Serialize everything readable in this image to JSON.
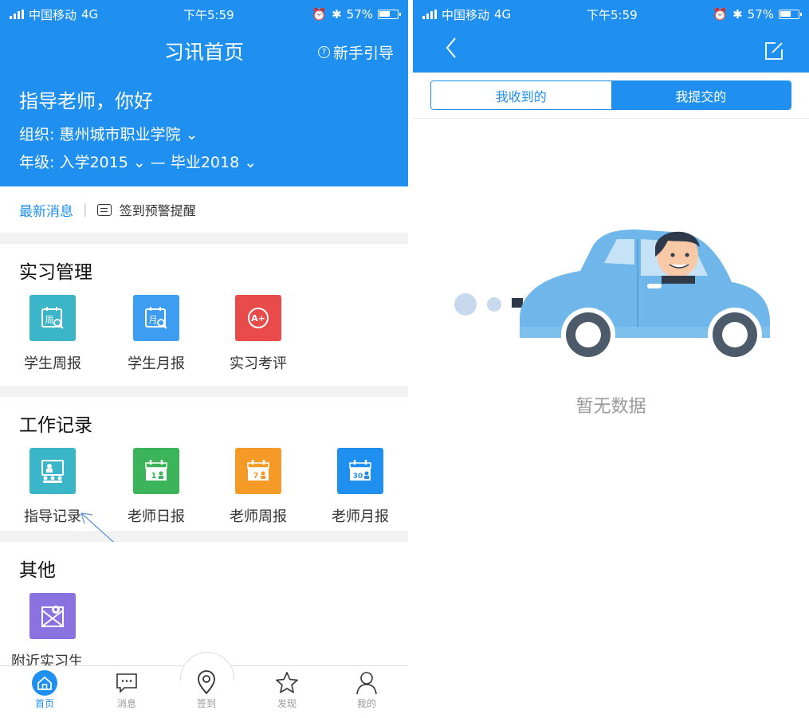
{
  "left": {
    "status": {
      "carrier": "中国移动",
      "network": "4G",
      "time": "下午5:59",
      "battery": "57%"
    },
    "header": {
      "title": "习讯首页",
      "guide": "新手引导",
      "greeting": "指导老师，你好",
      "org": "组织: 惠州城市职业学院 ⌄",
      "grade": "年级: 入学2015 ⌄ — 毕业2018 ⌄"
    },
    "news": {
      "latest": "最新消息",
      "separator": "|",
      "warning": "签到预警提醒"
    },
    "sections": {
      "intern": {
        "title": "实习管理",
        "items": [
          "学生周报",
          "学生月报",
          "实习考评"
        ]
      },
      "work": {
        "title": "工作记录",
        "items": [
          "指导记录",
          "老师日报",
          "老师周报",
          "老师月报"
        ]
      },
      "other": {
        "title": "其他",
        "items": [
          "附近实习生"
        ]
      }
    },
    "icon_text": {
      "week": "周",
      "month": "月",
      "grade": "A+",
      "day_num": "1",
      "week_num": "7",
      "month_num": "30"
    },
    "tabs": [
      "首页",
      "消息",
      "签到",
      "发现",
      "我的"
    ],
    "colors": {
      "primary": "#1f8ff0",
      "teal": "#3bb6c8",
      "red": "#e94b4b",
      "green": "#3cb55a",
      "orange": "#f59a26",
      "blue": "#1f8ff0",
      "purple": "#8a72e0"
    }
  },
  "right": {
    "status": {
      "carrier": "中国移动",
      "network": "4G",
      "time": "下午5:59",
      "battery": "57%"
    },
    "segments": [
      "我收到的",
      "我提交的"
    ],
    "selected_segment": "我提交的",
    "empty": "暂无数据"
  }
}
